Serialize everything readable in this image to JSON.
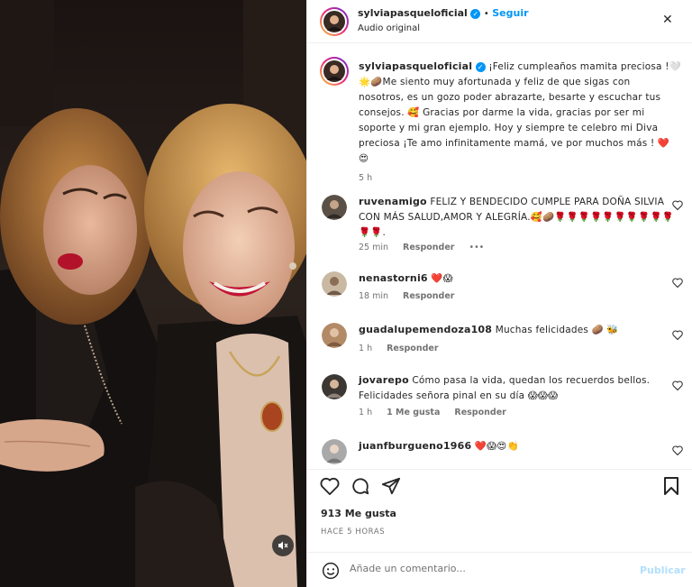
{
  "header": {
    "username": "sylviapasqueloficial",
    "follow_label": "Seguir",
    "separator": "•",
    "audio": "Audio original",
    "close": "✕"
  },
  "caption": {
    "username": "sylviapasqueloficial",
    "lines": [
      "¡Feliz cumpleaños mamita preciosa !🤍",
      "🌟🥔Me siento muy afortunada y feliz de que sigas con",
      "nosotros, es un gozo poder abrazarte, besarte y escuchar tus",
      "consejos. 🥰 Gracias por darme la vida, gracias por ser mi",
      "soporte y mi gran ejemplo. Hoy y siempre te celebro mi Diva",
      "preciosa ¡Te amo infinitamente mamá, ve por muchos más ! ❤️",
      "😍"
    ],
    "time": "5 h"
  },
  "comments": [
    {
      "username": "ruvenamigo",
      "lines": [
        "FELIZ Y BENDECIDO CUMPLE PARA DOÑA SILVIA",
        "CON MÁS SALUD,AMOR Y ALEGRÍA.🥰🥔🌹🌹🌹🌹🌹🌹🌹🌹🌹🌹",
        "🌹🌹."
      ],
      "time": "25 min",
      "reply": "Responder",
      "more": "•••"
    },
    {
      "username": "nenastorni6",
      "lines": [
        "❤️😱"
      ],
      "time": "18 min",
      "reply": "Responder"
    },
    {
      "username": "guadalupemendoza108",
      "lines": [
        "Muchas felicidades 🥔 🐝"
      ],
      "time": "1 h",
      "reply": "Responder"
    },
    {
      "username": "jovarepo",
      "lines": [
        "Cómo pasa la vida, quedan los recuerdos bellos.",
        "Felicidades señora pinal en su día 😱😱😱"
      ],
      "time": "1 h",
      "likes": "1 Me gusta",
      "reply": "Responder"
    },
    {
      "username": "juanfburgueno1966",
      "lines": [
        "❤️😱😍👏"
      ]
    }
  ],
  "actions": {
    "likes": "913 Me gusta",
    "posted": "HACE 5 HORAS"
  },
  "composer": {
    "placeholder": "Añade un comentario...",
    "publish": "Publicar"
  },
  "colors": {
    "accent": "#0095f6",
    "publish_disabled": "#b2dffc",
    "like_heart": "#ed4956"
  },
  "icons": [
    "close-icon",
    "verified-icon",
    "heart-icon",
    "comment-icon",
    "share-icon",
    "bookmark-icon",
    "emoji-icon",
    "speaker-muted-icon"
  ]
}
